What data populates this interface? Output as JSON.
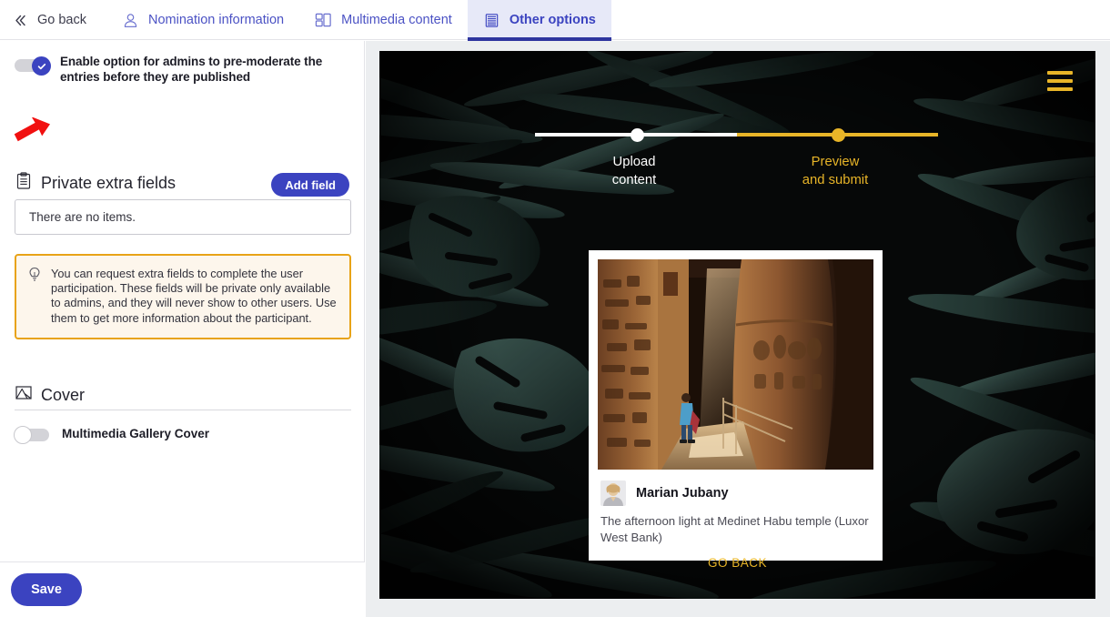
{
  "tabs": [
    {
      "label": "Go back",
      "icon": "chevrons-left-icon",
      "active": false
    },
    {
      "label": "Nomination information",
      "icon": "user-icon",
      "active": false
    },
    {
      "label": "Multimedia content",
      "icon": "layout-grid-icon",
      "active": false
    },
    {
      "label": "Other options",
      "icon": "list-lines-icon",
      "active": true
    }
  ],
  "sidebar": {
    "premoderate": {
      "label": "Enable option for admins to pre-moderate the entries before they are published",
      "state": "on",
      "annotation": "red-arrow-pointing-to-toggle"
    },
    "private_fields": {
      "title": "Private extra fields",
      "icon": "clipboard-list-icon",
      "add_button": "Add field",
      "empty_message": "There are no items."
    },
    "tip": {
      "icon": "lightbulb-icon",
      "text": "You can request extra fields to complete the user participation. These fields will be private only available to admins, and they will never show to other users. Use them to get more information about the participant."
    },
    "cover": {
      "title": "Cover",
      "icon": "image-icon",
      "toggle_label": "Multimedia Gallery Cover",
      "state": "off"
    },
    "save_label": "Save"
  },
  "preview": {
    "menu_icon": "hamburger-menu-icon",
    "stepper": {
      "steps": [
        {
          "label_line1": "Upload",
          "label_line2": "content",
          "state": "done",
          "color": "#ffffff"
        },
        {
          "label_line1": "Preview",
          "label_line2": "and submit",
          "state": "current",
          "color": "#e8b528"
        }
      ]
    },
    "entry_card": {
      "photo_alt": "Egyptian temple interior with columns and a visitor in blue",
      "avatar_alt": "Profile photo of Marian Jubany",
      "author": "Marian Jubany",
      "description": "The afternoon light at Medinet Habu temple (Luxor West Bank)"
    },
    "go_back_link": "GO BACK",
    "background_alt": "dark tropical palm and monstera leaves"
  },
  "colors": {
    "brand_blue": "#3b43c0",
    "active_tab_bg": "#e7e9f8",
    "accent_gold": "#e8b528",
    "tip_border": "#e8a317",
    "tip_bg": "#fdf6ec",
    "annotation_red": "#f11010"
  }
}
